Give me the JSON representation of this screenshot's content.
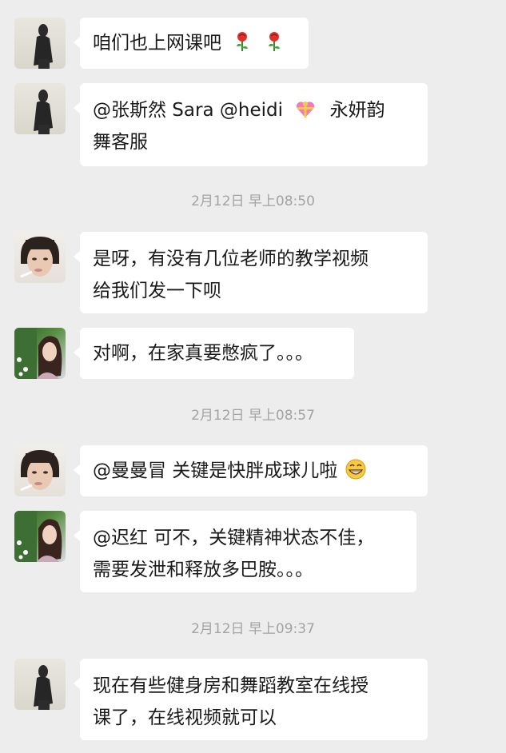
{
  "messages": [
    {
      "type": "msg",
      "avatar": "shadow-avatar",
      "text": "咱们也上网课吧",
      "emoji": [
        "rose-emoji",
        "rose-emoji"
      ]
    },
    {
      "type": "msg",
      "avatar": "shadow-avatar",
      "text_lines": [
        "@张斯然 Sara @heidi",
        "舞客服"
      ],
      "line1_tail": "永妍韵",
      "emoji": [
        "gift-heart-emoji"
      ]
    },
    {
      "type": "time",
      "text": "2月12日 早上08:50"
    },
    {
      "type": "msg",
      "avatar": "smoking-woman-avatar",
      "text_lines": [
        "是呀，有没有几位老师的教学视频",
        "给我们发一下呗"
      ]
    },
    {
      "type": "msg",
      "avatar": "garden-woman-avatar",
      "text": "对啊，在家真要憋疯了。。。"
    },
    {
      "type": "time",
      "text": "2月12日 早上08:57"
    },
    {
      "type": "msg",
      "avatar": "smoking-woman-avatar",
      "text": "@曼曼冒  关键是快胖成球儿啦",
      "emoji": [
        "grin-emoji"
      ]
    },
    {
      "type": "msg",
      "avatar": "garden-woman-avatar",
      "text_lines": [
        "@迟红  可不，关键精神状态不佳，",
        "需要发泄和释放多巴胺。。。"
      ]
    },
    {
      "type": "time",
      "text": "2月12日 早上09:37"
    },
    {
      "type": "msg",
      "avatar": "shadow-avatar",
      "text_lines": [
        "现在有些健身房和舞蹈教室在线授",
        "课了，在线视频就可以"
      ]
    }
  ]
}
